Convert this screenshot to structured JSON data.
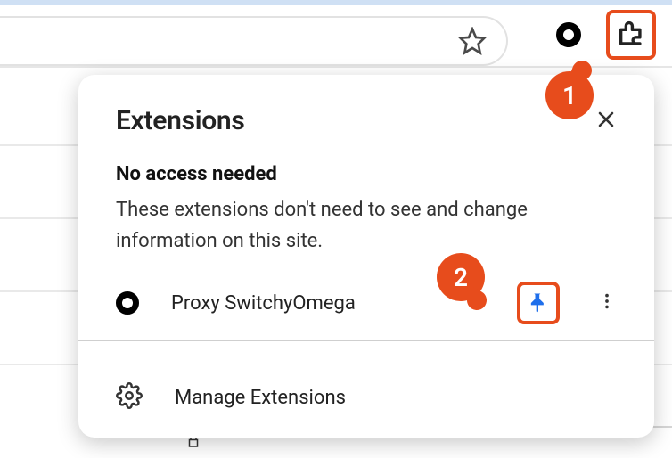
{
  "popup": {
    "title": "Extensions",
    "section_title": "No access needed",
    "section_desc": "These extensions don't need to see and change information on this site.",
    "items": [
      {
        "label": "Proxy SwitchyOmega"
      }
    ],
    "footer": {
      "label": "Manage Extensions"
    }
  },
  "annotations": {
    "badge1": "1",
    "badge2": "2"
  }
}
